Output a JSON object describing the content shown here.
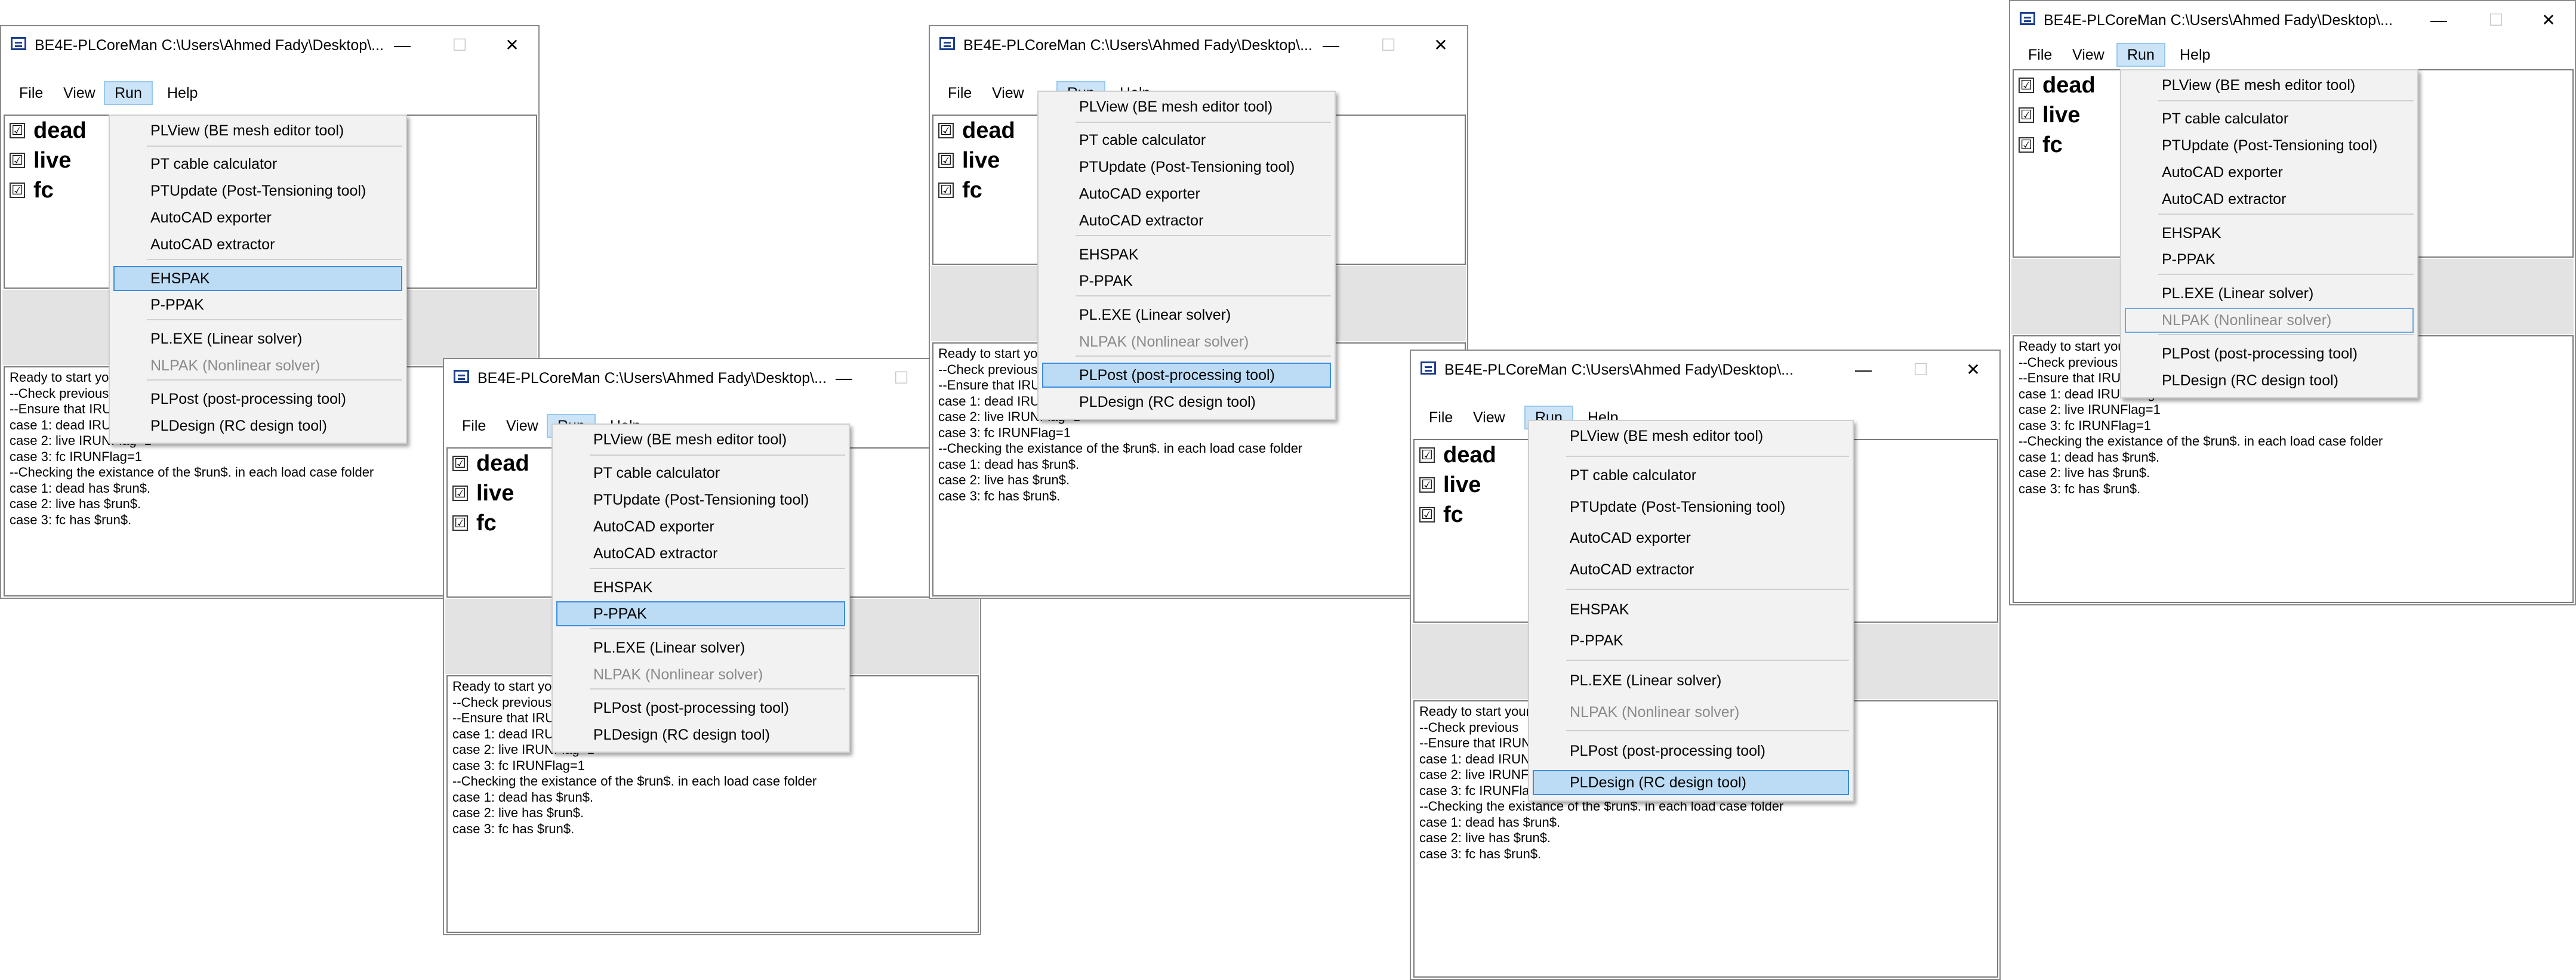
{
  "app": {
    "title": "BE4E-PLCoreMan C:\\Users\\Ahmed Fady\\Desktop\\...",
    "window_buttons": {
      "minimize": "—",
      "maximize": "☐",
      "close": "✕"
    }
  },
  "menubar": {
    "file": "File",
    "view": "View",
    "run": "Run",
    "help": "Help"
  },
  "cases": {
    "items": [
      {
        "label": "dead",
        "checked": true
      },
      {
        "label": "live",
        "checked": true
      },
      {
        "label": "fc",
        "checked": true
      }
    ],
    "check_glyph": "☑"
  },
  "run_menu": {
    "items": [
      "PLView (BE mesh editor tool)",
      "PT cable calculator",
      "PTUpdate (Post-Tensioning tool)",
      "AutoCAD exporter",
      "AutoCAD extractor",
      "EHSPAK",
      "P-PPAK",
      "PL.EXE (Linear solver)",
      "NLPAK (Nonlinear solver)",
      "PLPost (post-processing tool)",
      "PLDesign (RC design tool)"
    ],
    "disabled_item": "NLPAK (Nonlinear solver)"
  },
  "log": {
    "lines": [
      "Ready to start your",
      "--Check previous",
      "--Ensure that IRUN",
      "case 1: dead IRUNFlag=1",
      "case 2: live IRUNFlag=1",
      "case 3: fc IRUNFlag=1",
      "--Checking the existance of the $run$. in each load case folder",
      "case 1: dead has $run$.",
      "case 2: live has $run$.",
      "case 3: fc has $run$."
    ]
  },
  "screenshots": [
    {
      "highlighted_item": "EHSPAK"
    },
    {
      "highlighted_item": "P-PPAK"
    },
    {
      "highlighted_item": "PLPost (post-processing tool)"
    },
    {
      "highlighted_item": "PLDesign (RC design tool)"
    },
    {
      "highlighted_item": "NLPAK (Nonlinear solver)"
    }
  ],
  "colors": {
    "menu_highlight": "#bcdcf5",
    "menu_highlight_border": "#3d8ddd",
    "menu_background": "#f2f2f2",
    "disabled_text": "#8a8a8a",
    "title_icon": "#1d3f8f"
  }
}
